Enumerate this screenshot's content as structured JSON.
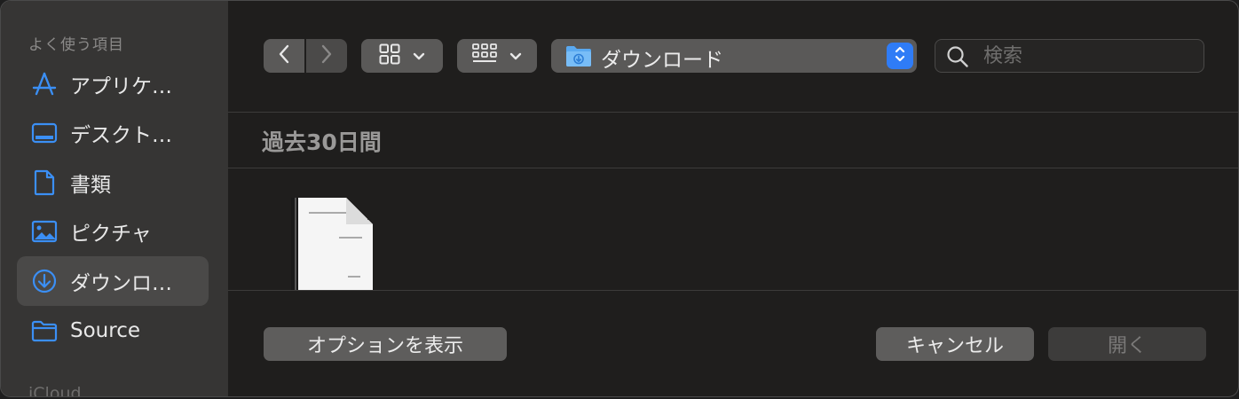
{
  "sidebar": {
    "section_favorites": "よく使う項目",
    "items": [
      {
        "label": "アプリケ…",
        "icon": "applications-icon"
      },
      {
        "label": "デスクト…",
        "icon": "desktop-icon"
      },
      {
        "label": "書類",
        "icon": "document-icon"
      },
      {
        "label": "ピクチャ",
        "icon": "pictures-icon"
      },
      {
        "label": "ダウンロ…",
        "icon": "downloads-icon",
        "selected": true
      },
      {
        "label": "Source",
        "icon": "folder-icon"
      }
    ],
    "section_icloud": "iCloud"
  },
  "toolbar": {
    "location_label": "ダウンロード",
    "search_placeholder": "検索"
  },
  "main": {
    "section_header": "過去30日間"
  },
  "footer": {
    "options_label": "オプションを表示",
    "cancel_label": "キャンセル",
    "open_label": "開く"
  },
  "colors": {
    "accent": "#2f7cf6",
    "icon_blue": "#3b8ff5",
    "sidebar_bg": "#363534",
    "content_bg": "#1f1e1d"
  }
}
